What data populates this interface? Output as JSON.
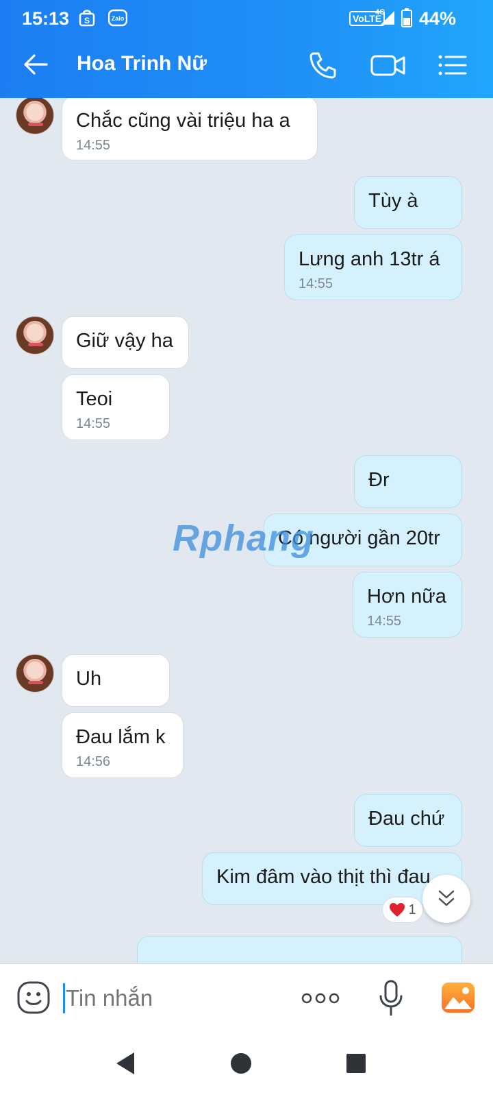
{
  "status_bar": {
    "time": "15:13",
    "network": "VoLTE",
    "signal": "4G",
    "battery": "44%"
  },
  "header": {
    "title": "Hoa Trinh Nữ"
  },
  "messages": [
    {
      "side": "in",
      "text": "Chắc cũng vài triệu ha a",
      "time": "14:55"
    },
    {
      "side": "out",
      "text": "Tùy à",
      "time": ""
    },
    {
      "side": "out",
      "text": "Lưng anh 13tr á",
      "time": "14:55"
    },
    {
      "side": "in",
      "text": "Giữ vậy ha",
      "time": ""
    },
    {
      "side": "in",
      "text": "Teoi",
      "time": "14:55"
    },
    {
      "side": "out",
      "text": "Đr",
      "time": ""
    },
    {
      "side": "out",
      "text": "Có người gần 20tr",
      "time": ""
    },
    {
      "side": "out",
      "text": "Hơn nữa",
      "time": "14:55"
    },
    {
      "side": "in",
      "text": "Uh",
      "time": ""
    },
    {
      "side": "in",
      "text": "Đau lắm k",
      "time": "14:56"
    },
    {
      "side": "out",
      "text": "Đau chứ",
      "time": ""
    },
    {
      "side": "out",
      "text": "Kim đâm vào thịt thì đau",
      "time": ""
    }
  ],
  "reaction": {
    "icon": "heart-icon",
    "count": "1"
  },
  "watermark": {
    "text": "Rphang"
  },
  "input": {
    "placeholder": "Tin nhắn"
  },
  "colors": {
    "header_start": "#1c7ef2",
    "header_end": "#21a5fb",
    "outgoing_bubble": "#d5f1fd",
    "incoming_bubble": "#ffffff",
    "chat_bg": "#e2e8ef"
  }
}
